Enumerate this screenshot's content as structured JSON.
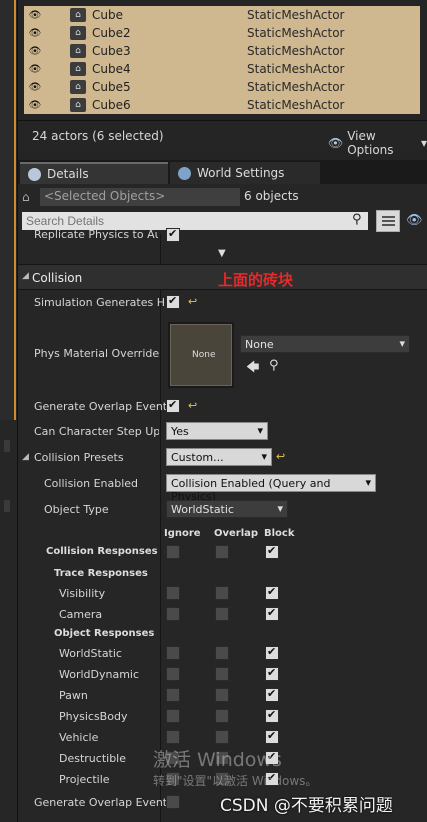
{
  "outliner": {
    "rows": [
      {
        "name": "Cube",
        "type": "StaticMeshActor"
      },
      {
        "name": "Cube2",
        "type": "StaticMeshActor"
      },
      {
        "name": "Cube3",
        "type": "StaticMeshActor"
      },
      {
        "name": "Cube4",
        "type": "StaticMeshActor"
      },
      {
        "name": "Cube5",
        "type": "StaticMeshActor"
      },
      {
        "name": "Cube6",
        "type": "StaticMeshActor"
      }
    ],
    "actors_count": "24 actors (6 selected)",
    "view_options": "View Options"
  },
  "tabs": {
    "details": "Details",
    "world_settings": "World Settings"
  },
  "selection": {
    "placeholder": "<Selected Objects>",
    "count": "6 objects"
  },
  "search": {
    "placeholder": "Search Details"
  },
  "props": {
    "replicate_physics": "Replicate Physics to Auto",
    "section": "Collision",
    "note": "上面的砖块",
    "sim_generates_hit": "Simulation Generates Hit",
    "phys_material": "Phys Material Override",
    "phys_thumb": "None",
    "phys_combo": "None",
    "gen_overlap": "Generate Overlap Events",
    "char_step": "Can Character Step Up On",
    "char_step_val": "Yes",
    "presets": "Collision Presets",
    "presets_val": "Custom...",
    "enabled": "Collision Enabled",
    "enabled_val": "Collision Enabled (Query and Physics)",
    "object_type": "Object Type",
    "object_type_val": "WorldStatic"
  },
  "responses": {
    "col_ignore": "Ignore",
    "col_overlap": "Overlap",
    "col_block": "Block",
    "title": "Collision Responses",
    "trace": "Trace Responses",
    "object": "Object Responses",
    "trace_items": [
      "Visibility",
      "Camera"
    ],
    "object_items": [
      "WorldStatic",
      "WorldDynamic",
      "Pawn",
      "PhysicsBody",
      "Vehicle",
      "Destructible",
      "Projectile"
    ],
    "gen_overlap2": "Generate Overlap Events"
  },
  "watermark": {
    "line1": "激活 Windows",
    "line2": "转到\"设置\"以激活 Windows。",
    "csdn": "CSDN @不要积累问题"
  }
}
